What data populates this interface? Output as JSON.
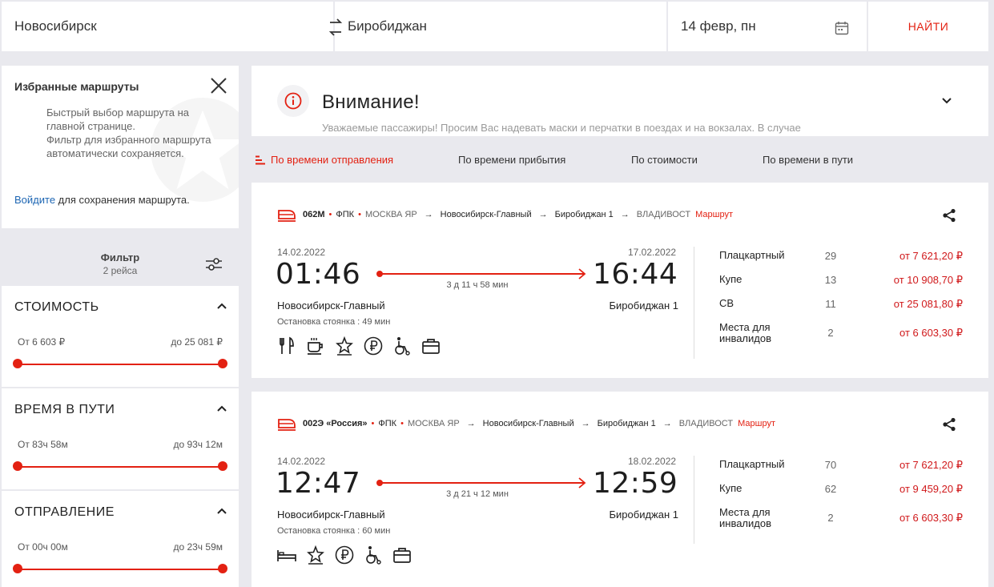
{
  "search": {
    "from": "Новосибирск",
    "to": "Биробиджан",
    "date": "14 февр, пн",
    "find_label": "НАЙТИ"
  },
  "favorites": {
    "title": "Избранные маршруты",
    "desc_1": "Быстрый выбор маршрута на главной странице.",
    "desc_2": "Фильтр для избранного маршрута автоматически сохраняется.",
    "login_link": "Войдите",
    "login_rest": " для сохранения маршрута."
  },
  "filter": {
    "title": "Фильтр",
    "count": "2 рейса",
    "blocks": [
      {
        "title": "СТОИМОСТЬ",
        "lo": "От 6 603 ₽",
        "hi": "до 25 081 ₽"
      },
      {
        "title": "ВРЕМЯ В ПУТИ",
        "lo": "От 83ч 58м",
        "hi": "до 93ч 12м"
      },
      {
        "title": "ОТПРАВЛЕНИЕ",
        "lo": "От 00ч 00м",
        "hi": "до 23ч 59м"
      }
    ]
  },
  "notice": {
    "title": "Внимание!",
    "text": "Уважаемые пассажиры! Просим Вас надевать маски и перчатки в поездах и на вокзалах. В случае"
  },
  "sort": {
    "by_departure": "По времени отправления",
    "by_arrival": "По времени прибытия",
    "by_price": "По стоимости",
    "by_duration": "По времени в пути"
  },
  "trains": [
    {
      "number": "062М",
      "carrier": "ФПК",
      "origin": "МОСКВА ЯР",
      "from_station": "Новосибирск-Главный",
      "to_station": "Биробиджан 1",
      "destination": "ВЛАДИВОСТ",
      "route_label": "Маршрут",
      "dep_date": "14.02.2022",
      "arr_date": "17.02.2022",
      "dep_time": "01:46",
      "arr_time": "16:44",
      "duration": "3 д 11 ч 58 мин",
      "dep_station": "Новосибирск-Главный",
      "arr_station": "Биробиджан 1",
      "stop_label": "Остановка",
      "stop_value": "стоянка : 49 мин",
      "classes": [
        {
          "name": "Плацкартный",
          "seats": "29",
          "price": "от 7 621,20 ₽"
        },
        {
          "name": "Купе",
          "seats": "13",
          "price": "от 10 908,70 ₽"
        },
        {
          "name": "СВ",
          "seats": "11",
          "price": "от 25 081,80 ₽"
        },
        {
          "name": "Места для инвалидов",
          "seats": "2",
          "price": "от 6 603,30 ₽"
        }
      ],
      "amenities": [
        "fork-knife-icon",
        "coffee-icon",
        "star-icon",
        "ruble-icon",
        "wheelchair-icon",
        "luggage-icon"
      ]
    },
    {
      "number": "002Э «Россия»",
      "carrier": "ФПК",
      "origin": "МОСКВА ЯР",
      "from_station": "Новосибирск-Главный",
      "to_station": "Биробиджан 1",
      "destination": "ВЛАДИВОСТ",
      "route_label": "Маршрут",
      "dep_date": "14.02.2022",
      "arr_date": "18.02.2022",
      "dep_time": "12:47",
      "arr_time": "12:59",
      "duration": "3 д 21 ч 12 мин",
      "dep_station": "Новосибирск-Главный",
      "arr_station": "Биробиджан 1",
      "stop_label": "Остановка",
      "stop_value": "стоянка : 60 мин",
      "classes": [
        {
          "name": "Плацкартный",
          "seats": "70",
          "price": "от 7 621,20 ₽"
        },
        {
          "name": "Купе",
          "seats": "62",
          "price": "от 9 459,20 ₽"
        },
        {
          "name": "Места для инвалидов",
          "seats": "2",
          "price": "от 6 603,30 ₽"
        }
      ],
      "amenities": [
        "bed-icon",
        "star-icon",
        "ruble-icon",
        "wheelchair-icon",
        "luggage-icon"
      ]
    }
  ]
}
